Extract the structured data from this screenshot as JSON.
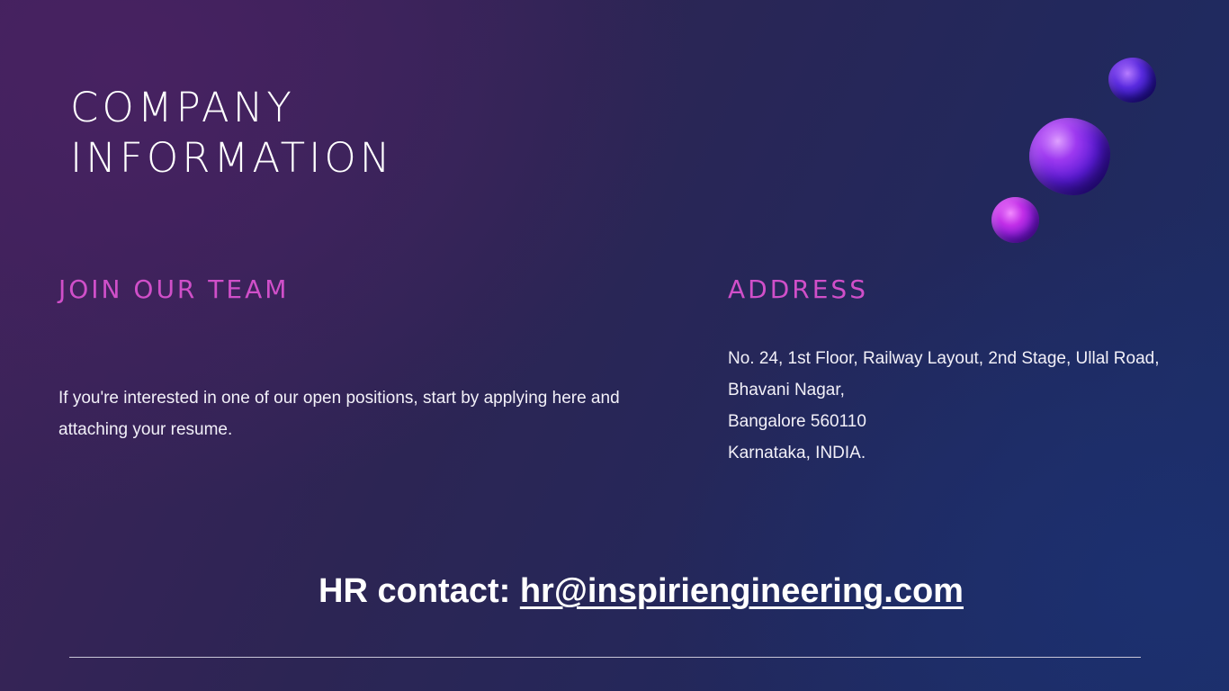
{
  "title": "COMPANY INFORMATION",
  "join": {
    "heading": "JOIN OUR TEAM",
    "body": "If you're interested in one of our open positions, start by applying here and attaching your resume."
  },
  "address": {
    "heading": "ADDRESS",
    "lines": [
      "No. 24, 1st Floor, Railway Layout, 2nd Stage, Ullal Road,",
      "Bhavani Nagar,",
      "Bangalore 560110",
      "Karnataka, INDIA."
    ]
  },
  "hr": {
    "label": "HR contact: ",
    "email": "hr@inspiriengineering.com"
  },
  "colors": {
    "accent": "#d04fc9",
    "text": "#ffffff",
    "background_start": "#3f2259",
    "background_end": "#1c2e66"
  }
}
